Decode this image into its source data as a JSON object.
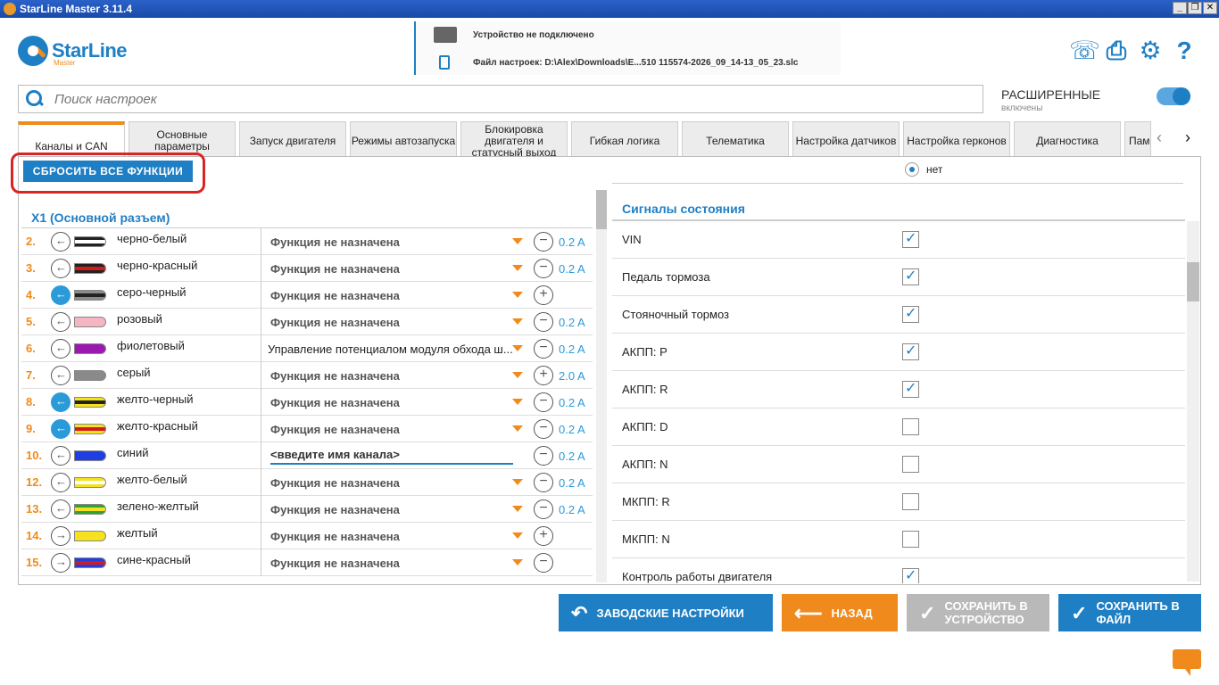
{
  "window": {
    "title": "StarLine Master 3.11.4",
    "controls": [
      "_",
      "❐",
      "✕"
    ]
  },
  "logo": {
    "brand": "StarLine",
    "sub": "Master"
  },
  "device": {
    "status": "Устройство не подключено",
    "file": "Файл настроек: D:\\Alex\\Downloads\\E...510 115574-2026_09_14-13_05_23.slc",
    "device_icon": "device-icon",
    "file_icon": "file-icon"
  },
  "top_icons": [
    "support-icon",
    "print-icon",
    "settings-icon",
    "help-icon"
  ],
  "search": {
    "placeholder": "Поиск настроек"
  },
  "advanced": {
    "label": "РАСШИРЕННЫЕ",
    "status": "включены"
  },
  "tabs": [
    {
      "label": "Каналы и CAN",
      "active": true
    },
    {
      "label": "Основные параметры"
    },
    {
      "label": "Запуск двигателя"
    },
    {
      "label": "Режимы автозапуска"
    },
    {
      "label": "Блокировка двигателя и статусный выход"
    },
    {
      "label": "Гибкая логика"
    },
    {
      "label": "Телематика"
    },
    {
      "label": "Настройка датчиков"
    },
    {
      "label": "Настройка герконов"
    },
    {
      "label": "Диагностика"
    },
    {
      "label": "Пам"
    }
  ],
  "tab_nav": {
    "prev": "‹",
    "next": "›"
  },
  "reset_label": "СБРОСИТЬ ВСЕ ФУНКЦИИ",
  "connector": {
    "title": "X1 (Основной разъем)"
  },
  "channels": [
    {
      "num": "2.",
      "name": "черно-белый",
      "func": "Функция не назначена",
      "pol": "−",
      "amp": "0.2 A",
      "dir": "in",
      "active": false,
      "wire": [
        "#222",
        "#fff"
      ]
    },
    {
      "num": "3.",
      "name": "черно-красный",
      "func": "Функция не назначена",
      "pol": "−",
      "amp": "0.2 A",
      "dir": "in",
      "active": false,
      "wire": [
        "#222",
        "#d21c1c"
      ]
    },
    {
      "num": "4.",
      "name": "серо-черный",
      "func": "Функция не назначена",
      "pol": "+",
      "amp": "",
      "dir": "in",
      "active": true,
      "wire": [
        "#8a8a8a",
        "#222"
      ]
    },
    {
      "num": "5.",
      "name": "розовый",
      "func": "Функция не назначена",
      "pol": "−",
      "amp": "0.2 A",
      "dir": "in",
      "active": false,
      "wire": [
        "#f5b6c4",
        "#f5b6c4"
      ]
    },
    {
      "num": "6.",
      "name": "фиолетовый",
      "func": "Управление потенциалом модуля обхода ш...",
      "pol": "−",
      "amp": "0.2 A",
      "dir": "in",
      "active": false,
      "wire": [
        "#9a1ab0",
        "#9a1ab0"
      ],
      "assigned": true
    },
    {
      "num": "7.",
      "name": "серый",
      "func": "Функция не назначена",
      "pol": "+",
      "amp": "2.0 A",
      "dir": "in",
      "active": false,
      "wire": [
        "#8a8a8a",
        "#8a8a8a"
      ]
    },
    {
      "num": "8.",
      "name": "желто-черный",
      "func": "Функция не назначена",
      "pol": "−",
      "amp": "0.2 A",
      "dir": "in",
      "active": true,
      "wire": [
        "#f5e11e",
        "#222"
      ]
    },
    {
      "num": "9.",
      "name": "желто-красный",
      "func": "Функция не назначена",
      "pol": "−",
      "amp": "0.2 A",
      "dir": "in",
      "active": true,
      "wire": [
        "#f5e11e",
        "#d21c1c"
      ]
    },
    {
      "num": "10.",
      "name": "синий",
      "func": "<введите имя канала>",
      "pol": "−",
      "amp": "0.2 A",
      "dir": "in",
      "active": false,
      "wire": [
        "#1f3fe0",
        "#1f3fe0"
      ],
      "edit": true
    },
    {
      "num": "12.",
      "name": "желто-белый",
      "func": "Функция не назначена",
      "pol": "−",
      "amp": "0.2 A",
      "dir": "in",
      "active": false,
      "wire": [
        "#f5e11e",
        "#fff"
      ]
    },
    {
      "num": "13.",
      "name": "зелено-желтый",
      "func": "Функция не назначена",
      "pol": "−",
      "amp": "0.2 A",
      "dir": "in",
      "active": false,
      "wire": [
        "#2ea32e",
        "#f5e11e"
      ]
    },
    {
      "num": "14.",
      "name": "желтый",
      "func": "Функция не назначена",
      "pol": "+",
      "amp": "",
      "dir": "out",
      "active": false,
      "wire": [
        "#f5e11e",
        "#f5e11e"
      ]
    },
    {
      "num": "15.",
      "name": "сине-красный",
      "func": "Функция не назначена",
      "pol": "−",
      "amp": "",
      "dir": "out",
      "active": false,
      "wire": [
        "#1f3fe0",
        "#d21c1c"
      ]
    }
  ],
  "right": {
    "radio_label": "нет",
    "signals_title": "Сигналы состояния",
    "signals": [
      {
        "label": "VIN",
        "checked": true
      },
      {
        "label": "Педаль тормоза",
        "checked": true
      },
      {
        "label": "Стояночный тормоз",
        "checked": true
      },
      {
        "label": "АКПП: P",
        "checked": true
      },
      {
        "label": "АКПП: R",
        "checked": true
      },
      {
        "label": "АКПП: D",
        "checked": false
      },
      {
        "label": "АКПП: N",
        "checked": false
      },
      {
        "label": "МКПП: R",
        "checked": false
      },
      {
        "label": "МКПП: N",
        "checked": false
      },
      {
        "label": "Контроль работы двигателя",
        "checked": true
      }
    ]
  },
  "buttons": {
    "factory": "ЗАВОДСКИЕ НАСТРОЙКИ",
    "back": "НАЗАД",
    "save_device": "СОХРАНИТЬ В УСТРОЙСТВО",
    "save_file": "СОХРАНИТЬ В ФАЙЛ"
  },
  "colors": {
    "accent": "#1f7fc4",
    "orange": "#f08a1c",
    "highlight": "#d72424"
  }
}
